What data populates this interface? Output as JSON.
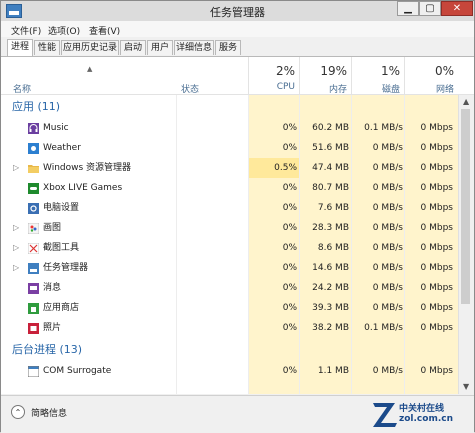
{
  "window": {
    "title": "任务管理器",
    "min_glyph": "▁",
    "max_glyph": "▢",
    "close_glyph": "✕"
  },
  "menu": [
    {
      "label": "文件(F)"
    },
    {
      "label": "选项(O)"
    },
    {
      "label": "查看(V)"
    }
  ],
  "tabs": [
    {
      "label": "进程",
      "active": true
    },
    {
      "label": "性能"
    },
    {
      "label": "应用历史记录"
    },
    {
      "label": "启动"
    },
    {
      "label": "用户"
    },
    {
      "label": "详细信息"
    },
    {
      "label": "服务"
    }
  ],
  "header": {
    "name": "名称",
    "status": "状态",
    "cpu": {
      "pct": "2%",
      "label": "CPU"
    },
    "memory": {
      "pct": "19%",
      "label": "内存"
    },
    "disk": {
      "pct": "1%",
      "label": "磁盘"
    },
    "network": {
      "pct": "0%",
      "label": "网络"
    }
  },
  "sections": {
    "apps": "应用 (11)",
    "background": "后台进程 (13)"
  },
  "apps": [
    {
      "name": "Music",
      "icon": "headphones-icon",
      "expandable": false,
      "cpu": "0%",
      "mem": "60.2 MB",
      "disk": "0.1 MB/s",
      "net": "0 Mbps"
    },
    {
      "name": "Weather",
      "icon": "sun-icon",
      "expandable": false,
      "cpu": "0%",
      "mem": "51.6 MB",
      "disk": "0 MB/s",
      "net": "0 Mbps"
    },
    {
      "name": "Windows 资源管理器",
      "icon": "folder-icon",
      "expandable": true,
      "cpu": "0.5%",
      "mem": "47.4 MB",
      "disk": "0 MB/s",
      "net": "0 Mbps",
      "hot": true
    },
    {
      "name": "Xbox LIVE Games",
      "icon": "gamepad-icon",
      "expandable": false,
      "cpu": "0%",
      "mem": "80.7 MB",
      "disk": "0 MB/s",
      "net": "0 Mbps"
    },
    {
      "name": "电脑设置",
      "icon": "gear-icon",
      "expandable": false,
      "cpu": "0%",
      "mem": "7.6 MB",
      "disk": "0 MB/s",
      "net": "0 Mbps"
    },
    {
      "name": "画图",
      "icon": "paint-icon",
      "expandable": true,
      "cpu": "0%",
      "mem": "28.3 MB",
      "disk": "0 MB/s",
      "net": "0 Mbps"
    },
    {
      "name": "截图工具",
      "icon": "scissors-icon",
      "expandable": true,
      "cpu": "0%",
      "mem": "8.6 MB",
      "disk": "0 MB/s",
      "net": "0 Mbps"
    },
    {
      "name": "任务管理器",
      "icon": "task-manager-icon",
      "expandable": true,
      "cpu": "0%",
      "mem": "14.6 MB",
      "disk": "0 MB/s",
      "net": "0 Mbps"
    },
    {
      "name": "消息",
      "icon": "chat-icon",
      "expandable": false,
      "cpu": "0%",
      "mem": "24.2 MB",
      "disk": "0 MB/s",
      "net": "0 Mbps"
    },
    {
      "name": "应用商店",
      "icon": "store-icon",
      "expandable": false,
      "cpu": "0%",
      "mem": "39.3 MB",
      "disk": "0 MB/s",
      "net": "0 Mbps"
    },
    {
      "name": "照片",
      "icon": "photo-icon",
      "expandable": false,
      "cpu": "0%",
      "mem": "38.2 MB",
      "disk": "0.1 MB/s",
      "net": "0 Mbps"
    }
  ],
  "background": [
    {
      "name": "COM Surrogate",
      "icon": "window-icon",
      "expandable": false,
      "cpu": "0%",
      "mem": "1.1 MB",
      "disk": "0 MB/s",
      "net": "0 Mbps"
    }
  ],
  "footer": {
    "label": "简略信息",
    "button_glyph": "⌃"
  },
  "watermark": {
    "line1": "中关村在线",
    "line2": "zol.com.cn"
  },
  "colors": {
    "heat": "#fff4cc",
    "hot": "#ffe99b",
    "section": "#2866a8",
    "close": "#c6463b"
  }
}
